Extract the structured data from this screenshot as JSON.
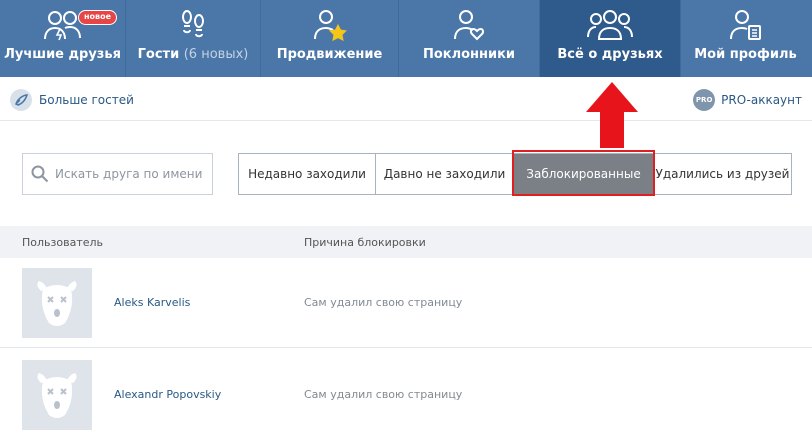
{
  "nav": {
    "items": [
      {
        "label": "Лучшие друзья",
        "sub": "",
        "badge": "новое",
        "icon": "best-friends-icon"
      },
      {
        "label": "Гости",
        "sub": "(6 новых)",
        "badge": "",
        "icon": "guests-footprints-icon"
      },
      {
        "label": "Продвижение",
        "sub": "",
        "badge": "",
        "icon": "promotion-star-icon"
      },
      {
        "label": "Поклонники",
        "sub": "",
        "badge": "",
        "icon": "fans-heart-icon"
      },
      {
        "label": "Всё о друзьях",
        "sub": "",
        "badge": "",
        "icon": "all-friends-icon",
        "active": true
      },
      {
        "label": "Мой профиль",
        "sub": "",
        "badge": "",
        "icon": "my-profile-icon"
      }
    ]
  },
  "subbar": {
    "more_guests": "Больше гостей",
    "pro_badge": "PRO",
    "pro_account": "PRO-аккаунт"
  },
  "search": {
    "placeholder": "Искать друга по имени",
    "value": ""
  },
  "filters": {
    "tabs": [
      {
        "label": "Недавно заходили",
        "active": false
      },
      {
        "label": "Давно не заходили",
        "active": false
      },
      {
        "label": "Заблокированные",
        "active": true
      },
      {
        "label": "Удалились из друзей",
        "active": false
      }
    ]
  },
  "table": {
    "headers": {
      "user": "Пользователь",
      "reason": "Причина блокировки"
    },
    "rows": [
      {
        "name": "Aleks Karvelis",
        "reason": "Сам удалил свою страницу"
      },
      {
        "name": "Alexandr Popovskiy",
        "reason": "Сам удалил свою страницу"
      }
    ]
  },
  "colors": {
    "nav_bg": "#4a76a8",
    "nav_active": "#2f5a8c",
    "link": "#2a5885",
    "active_tab": "#7b8087",
    "highlight": "#e02020"
  }
}
